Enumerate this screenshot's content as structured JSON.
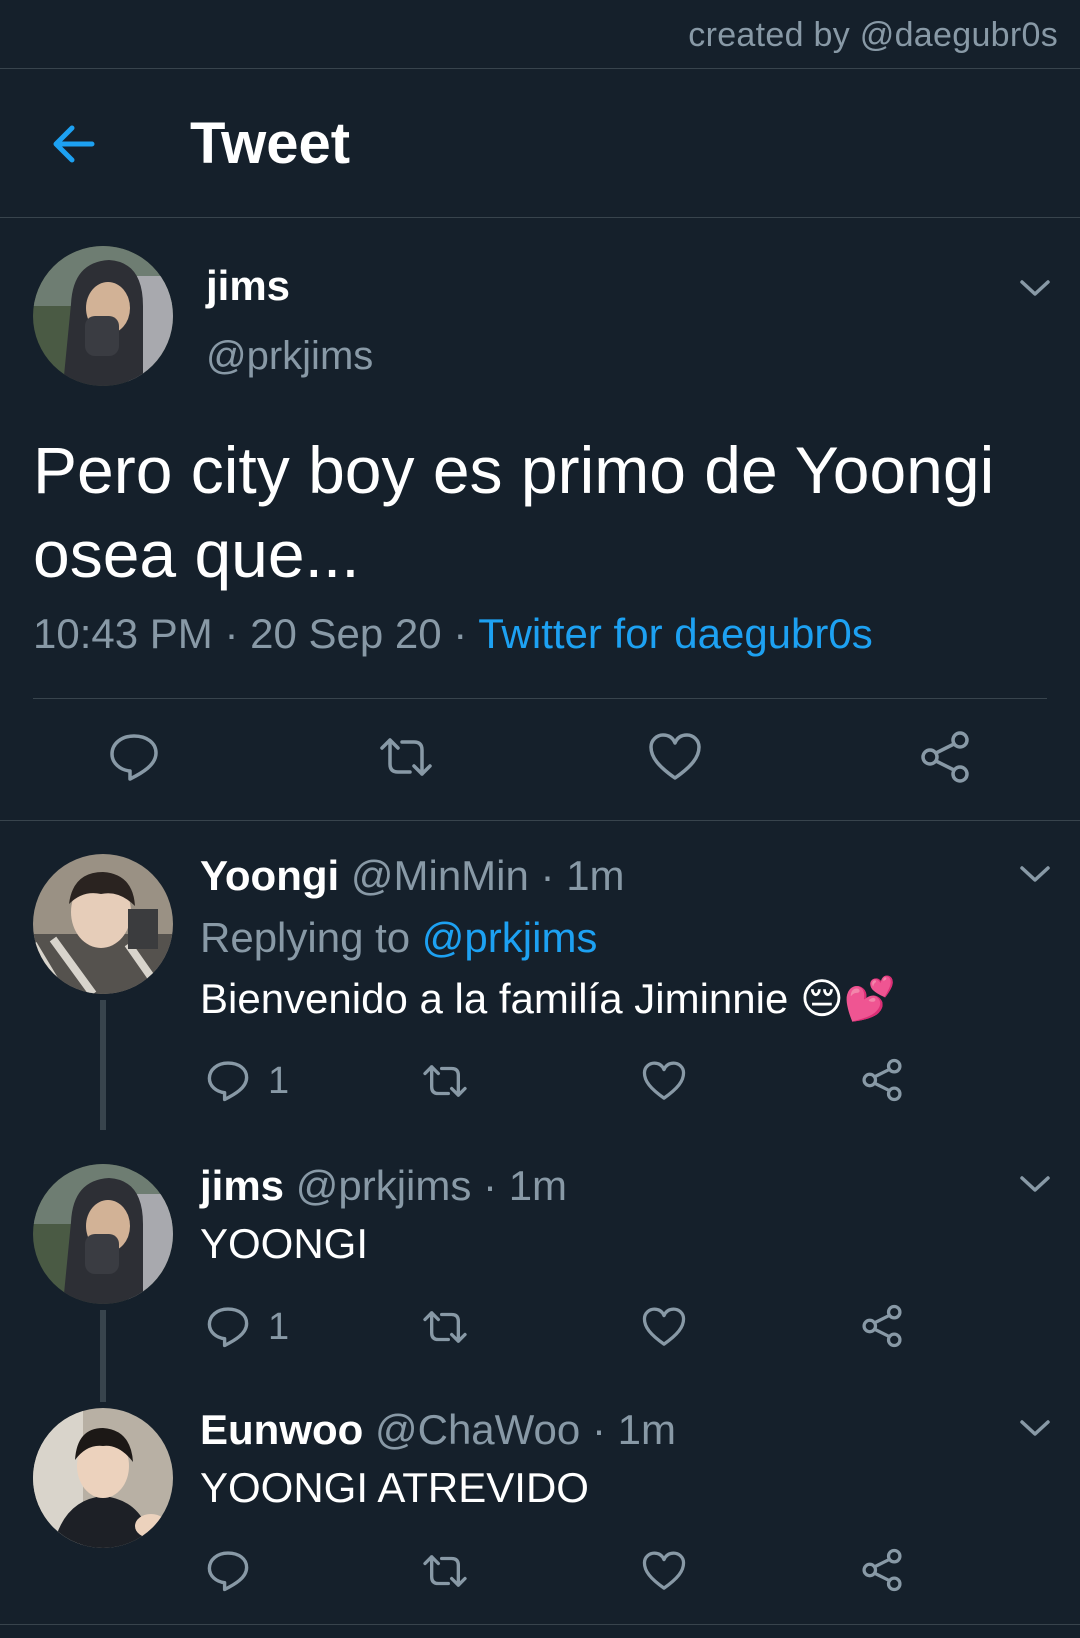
{
  "credit": "created by @daegubr0s",
  "header": {
    "title": "Tweet"
  },
  "main_tweet": {
    "name": "jims",
    "handle": "@prkjims",
    "text": "Pero city boy es primo de Yoongi osea que...",
    "time": "10:43 PM",
    "date": "20 Sep 20",
    "source": "Twitter for daegubr0s"
  },
  "replies": [
    {
      "name": "Yoongi",
      "handle": "@MinMin",
      "time": "1m",
      "replying_label": "Replying to",
      "replying_to": "@prkjims",
      "text": "Bienvenido a la familía Jiminnie",
      "emoji": "😔💕",
      "reply_count": "1"
    },
    {
      "name": "jims",
      "handle": "@prkjims",
      "time": "1m",
      "text": "YOONGI",
      "reply_count": "1"
    },
    {
      "name": "Eunwoo",
      "handle": "@ChaWoo",
      "time": "1m",
      "text": "YOONGI ATREVIDO",
      "reply_count": ""
    }
  ],
  "colors": {
    "background": "#15202b",
    "accent": "#1da1f2",
    "secondary_text": "#8899a6",
    "divider": "#38444d"
  },
  "icons": [
    "back-arrow-icon",
    "chevron-down-icon",
    "reply-icon",
    "retweet-icon",
    "like-icon",
    "share-icon"
  ]
}
